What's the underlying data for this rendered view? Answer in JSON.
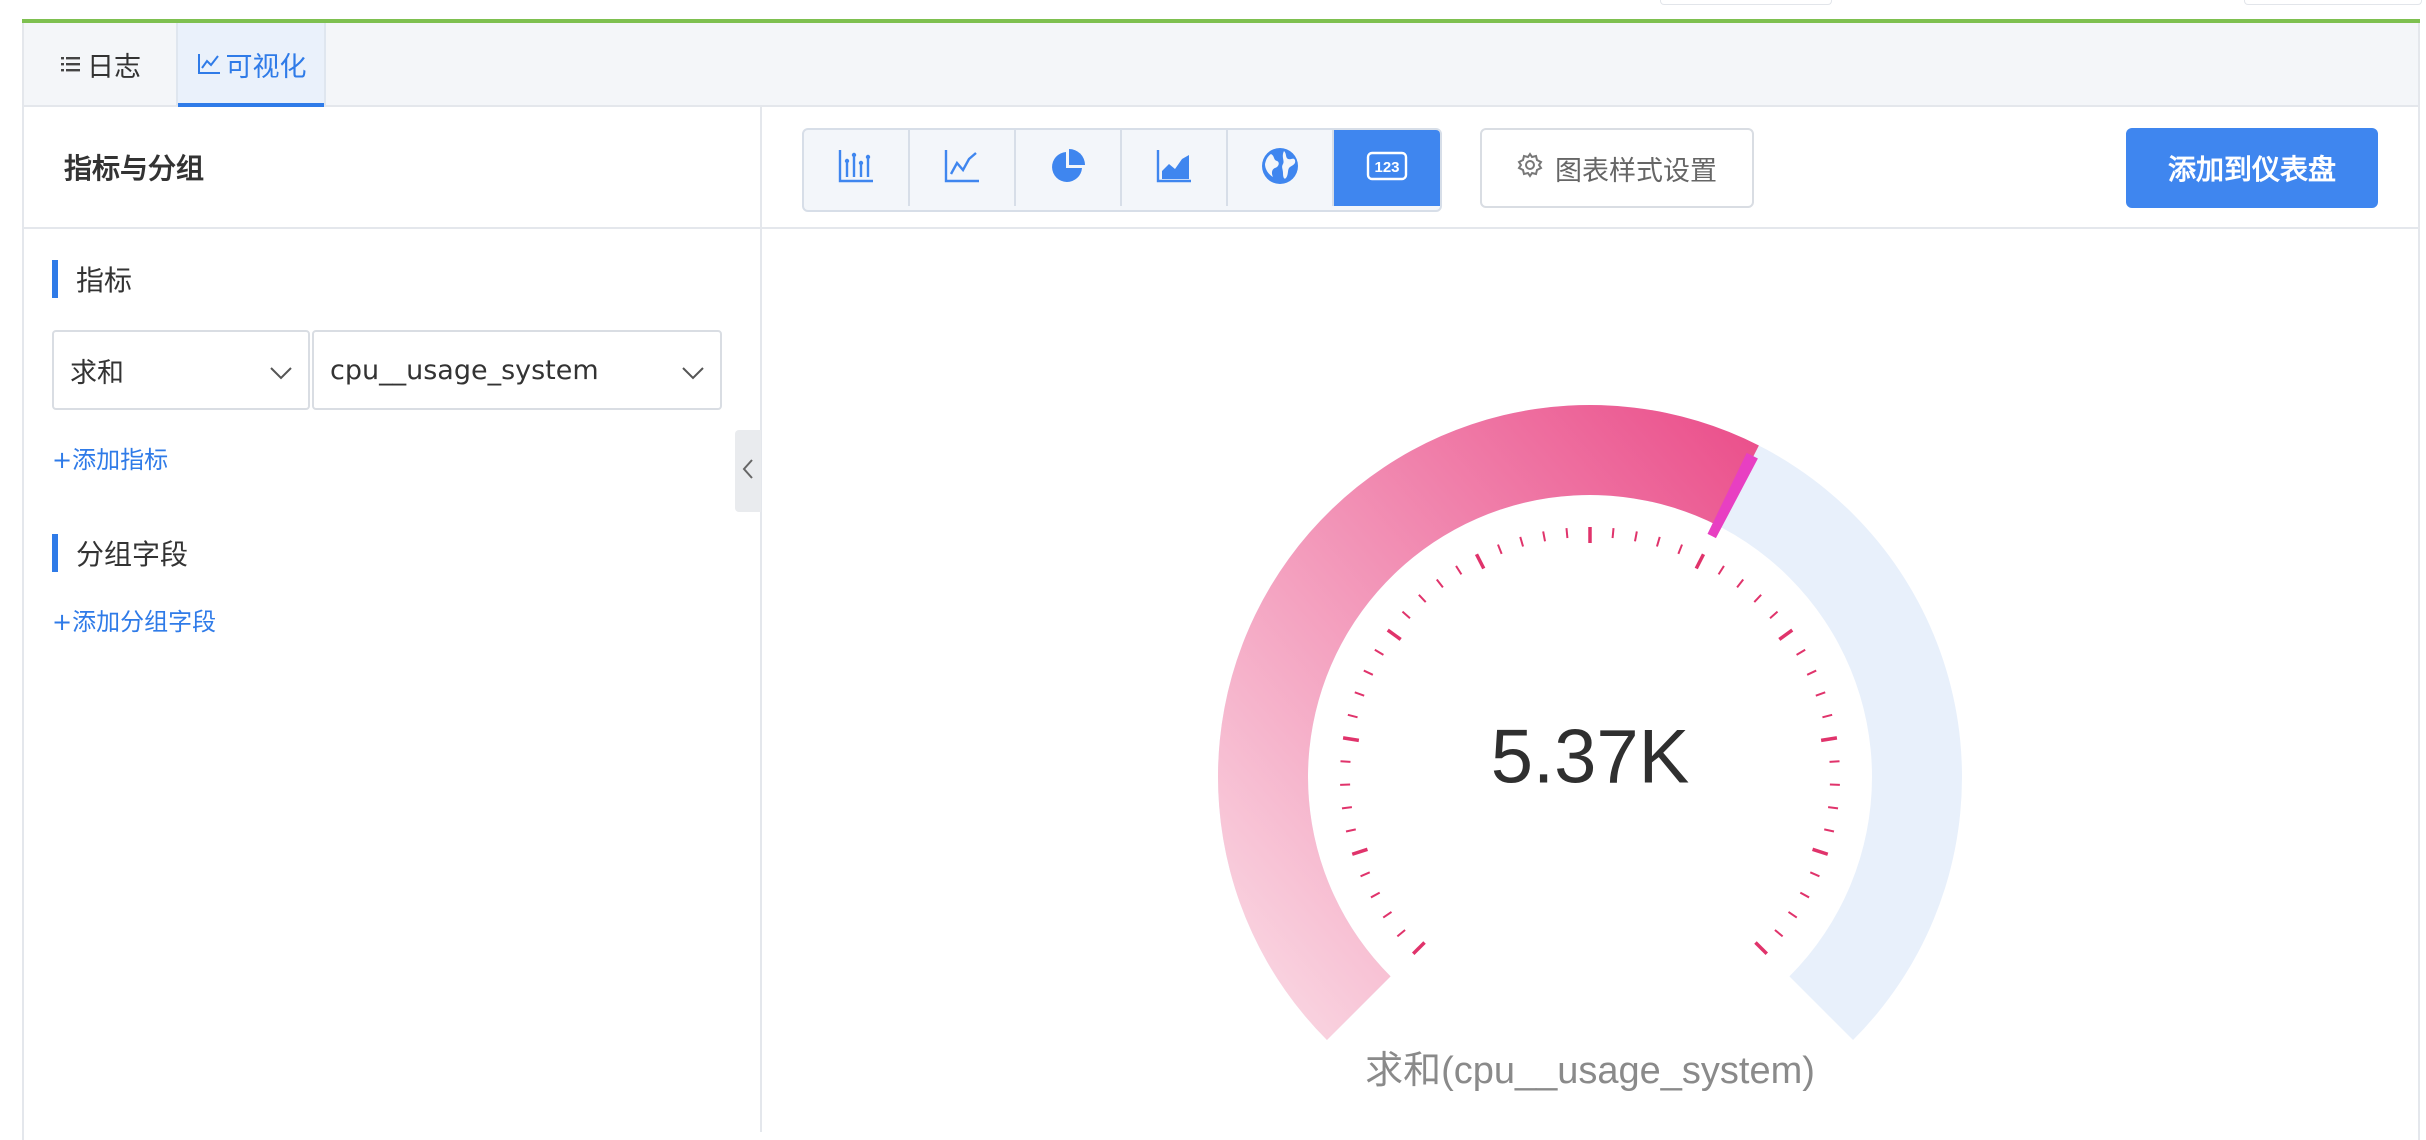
{
  "tabs": [
    {
      "label": "日志",
      "icon": "list-icon",
      "active": false
    },
    {
      "label": "可视化",
      "icon": "line-chart-icon",
      "active": true
    }
  ],
  "sidebar": {
    "title": "指标与分组",
    "metrics_section": {
      "title": "指标",
      "aggregation_select": "求和",
      "field_select": "cpu__usage_system",
      "add_link": "+添加指标"
    },
    "group_section": {
      "title": "分组字段",
      "add_link": "+添加分组字段"
    }
  },
  "toolbar": {
    "chart_types": [
      {
        "icon": "bar-chart-icon",
        "active": false
      },
      {
        "icon": "line-chart-icon",
        "active": false
      },
      {
        "icon": "pie-chart-icon",
        "active": false
      },
      {
        "icon": "area-chart-icon",
        "active": false
      },
      {
        "icon": "globe-icon",
        "active": false
      },
      {
        "icon": "number-123-icon",
        "active": true
      }
    ],
    "style_settings_label": "图表样式设置",
    "add_to_dashboard_label": "添加到仪表盘"
  },
  "gauge": {
    "value_display": "5.37K",
    "label": "求和(cpu__usage_system)",
    "fill_fraction": 0.6,
    "colors": {
      "fill_start": "#fbe0e8",
      "fill_end": "#ea4c89",
      "marker": "#e83fc2",
      "track": "#e8f0fb",
      "ticks": "#e0336b",
      "primary": "#3f86ef",
      "tab_underline": "#7ec050"
    }
  }
}
